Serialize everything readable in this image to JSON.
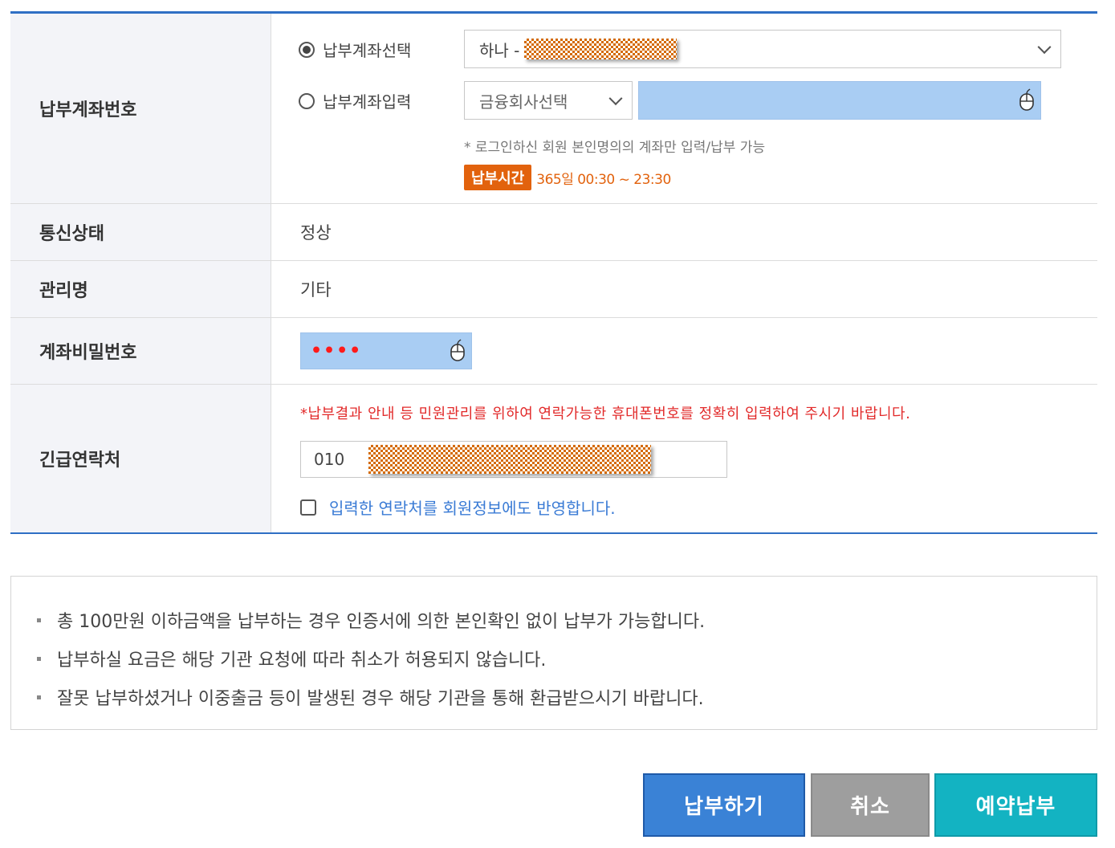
{
  "form": {
    "account_row": {
      "label": "납부계좌번호",
      "select_option_label": "납부계좌선택",
      "selected_account_prefix": "하나 -",
      "input_option_label": "납부계좌입력",
      "bank_select_placeholder": "금융회사선택",
      "note": "* 로그인하신 회원 본인명의의 계좌만 입력/납부 가능",
      "time_badge": "납부시간",
      "time_text": "365일 00:30 ~ 23:30"
    },
    "status_row": {
      "label": "통신상태",
      "value": "정상"
    },
    "manage_row": {
      "label": "관리명",
      "value": "기타"
    },
    "password_row": {
      "label": "계좌비밀번호",
      "value": "••••"
    },
    "contact_row": {
      "label": "긴급연락처",
      "notice": "*납부결과 안내 등 민원관리를 위하여 연락가능한 휴대폰번호를 정확히 입력하여 주시기 바랍니다.",
      "phone_prefix": "010",
      "checkbox_label": "입력한 연락처를 회원정보에도 반영합니다."
    }
  },
  "info": {
    "items": [
      "총 100만원 이하금액을 납부하는 경우 인증서에 의한 본인확인 없이 납부가 가능합니다.",
      "납부하실 요금은 해당 기관 요청에 따라 취소가 허용되지 않습니다.",
      "잘못 납부하셨거나 이중출금 등이 발생된 경우 해당 기관을 통해 환급받으시기 바랍니다."
    ]
  },
  "buttons": {
    "pay": "납부하기",
    "cancel": "취소",
    "reserve": "예약납부"
  },
  "colors": {
    "primary_blue": "#3a82d6",
    "accent_orange": "#e2620d",
    "notice_red": "#e22b2b",
    "link_blue": "#3a7bd5",
    "teal": "#13b3c2",
    "secure_input_bg": "#a9cdf3"
  },
  "icons": {
    "secure_input": "mouse-icon",
    "select_arrow": "chevron-down-icon"
  }
}
